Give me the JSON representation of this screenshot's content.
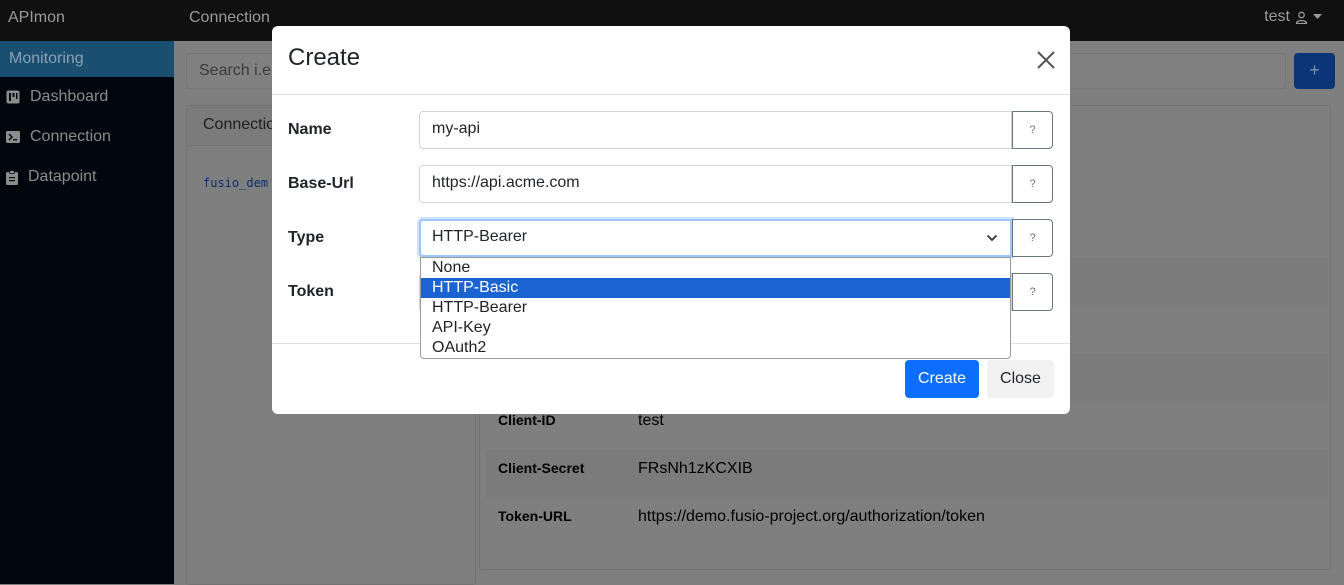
{
  "navbar": {
    "brand": "APImon",
    "breadcrumb": "Connection",
    "user": "test"
  },
  "sidebar": {
    "section": "Monitoring",
    "items": [
      {
        "label": "Dashboard",
        "icon": "kanban-icon"
      },
      {
        "label": "Connection",
        "icon": "terminal-icon"
      },
      {
        "label": "Datapoint",
        "icon": "clipboard-icon"
      }
    ]
  },
  "main": {
    "search_placeholder": "Search i.e",
    "add_label": "+",
    "list_header": "Connectio",
    "list_item": "fusio_dem",
    "details": [
      {
        "key": "Client-ID",
        "value": "test"
      },
      {
        "key": "Client-Secret",
        "value": "FRsNh1zKCXIB"
      },
      {
        "key": "Token-URL",
        "value": "https://demo.fusio-project.org/authorization/token"
      }
    ]
  },
  "modal": {
    "title": "Create",
    "fields": {
      "name": {
        "label": "Name",
        "value": "my-api",
        "help": "?"
      },
      "base_url": {
        "label": "Base-Url",
        "value": "https://api.acme.com",
        "help": "?"
      },
      "type": {
        "label": "Type",
        "value": "HTTP-Bearer",
        "help": "?"
      },
      "token": {
        "label": "Token",
        "help": "?"
      }
    },
    "type_options": [
      "None",
      "HTTP-Basic",
      "HTTP-Bearer",
      "API-Key",
      "OAuth2"
    ],
    "highlighted_option": "HTTP-Basic",
    "create_label": "Create",
    "close_label": "Close"
  }
}
